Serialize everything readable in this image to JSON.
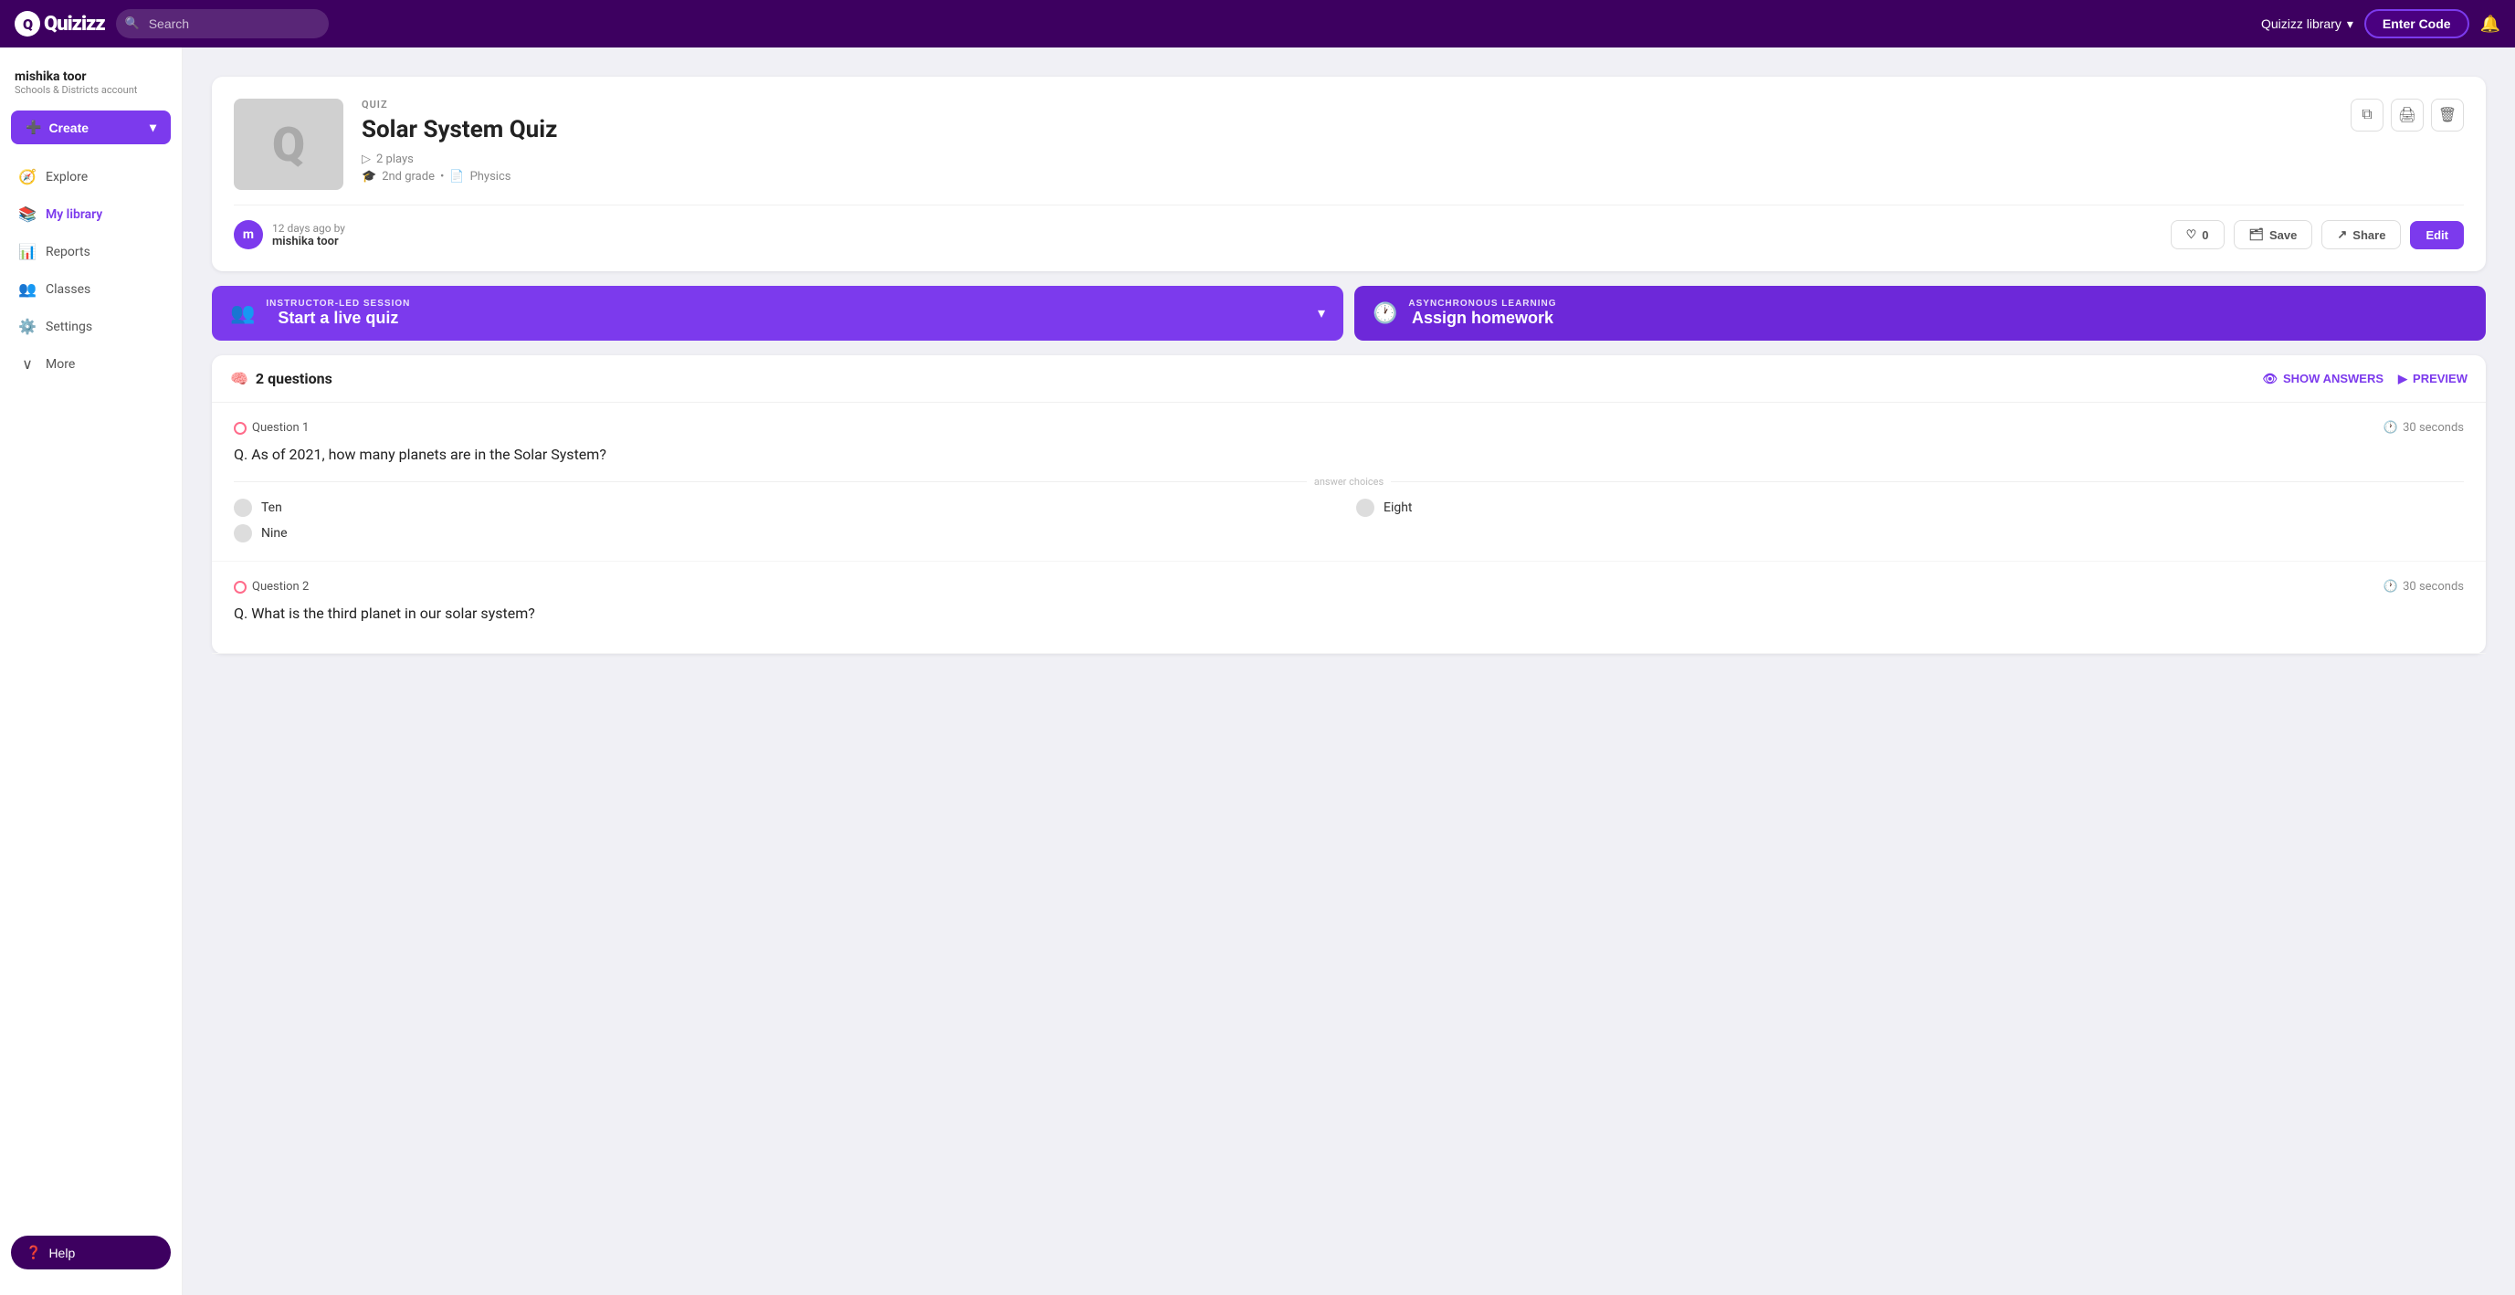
{
  "logo": {
    "text": "Quizizz"
  },
  "search": {
    "placeholder": "Search"
  },
  "nav": {
    "library_label": "Quizizz library",
    "enter_code": "Enter Code"
  },
  "sidebar": {
    "user": {
      "name": "mishika toor",
      "subtitle": "Schools & Districts account",
      "avatar_letter": "m"
    },
    "create_label": "Create",
    "items": [
      {
        "label": "Explore",
        "icon": "🧭",
        "active": false
      },
      {
        "label": "My library",
        "icon": "📚",
        "active": true
      },
      {
        "label": "Reports",
        "icon": "📊",
        "active": false
      },
      {
        "label": "Classes",
        "icon": "👥",
        "active": false
      },
      {
        "label": "Settings",
        "icon": "⚙️",
        "active": false
      },
      {
        "label": "More",
        "icon": "∨",
        "active": false
      }
    ],
    "help_label": "Help"
  },
  "quiz": {
    "badge": "QUIZ",
    "title": "Solar System Quiz",
    "plays": "2 plays",
    "grade": "2nd grade",
    "subject": "Physics",
    "days_ago": "12 days ago by",
    "author": "mishika toor",
    "avatar_letter": "m",
    "likes": "0",
    "save_label": "Save",
    "share_label": "Share",
    "edit_label": "Edit"
  },
  "sessions": {
    "live": {
      "type": "INSTRUCTOR-LED SESSION",
      "title": "Start a live quiz"
    },
    "hw": {
      "type": "ASYNCHRONOUS LEARNING",
      "title": "Assign homework"
    }
  },
  "questions": {
    "count_label": "2 questions",
    "show_answers": "SHOW ANSWERS",
    "preview": "PREVIEW",
    "items": [
      {
        "number": "Question 1",
        "time": "30 seconds",
        "text": "Q. As of 2021, how many planets are in the Solar System?",
        "answer_choices_label": "answer choices",
        "choices": [
          "Ten",
          "Eight",
          "Nine"
        ]
      },
      {
        "number": "Question 2",
        "time": "30 seconds",
        "text": "Q. What is the third planet in our solar system?"
      }
    ]
  }
}
